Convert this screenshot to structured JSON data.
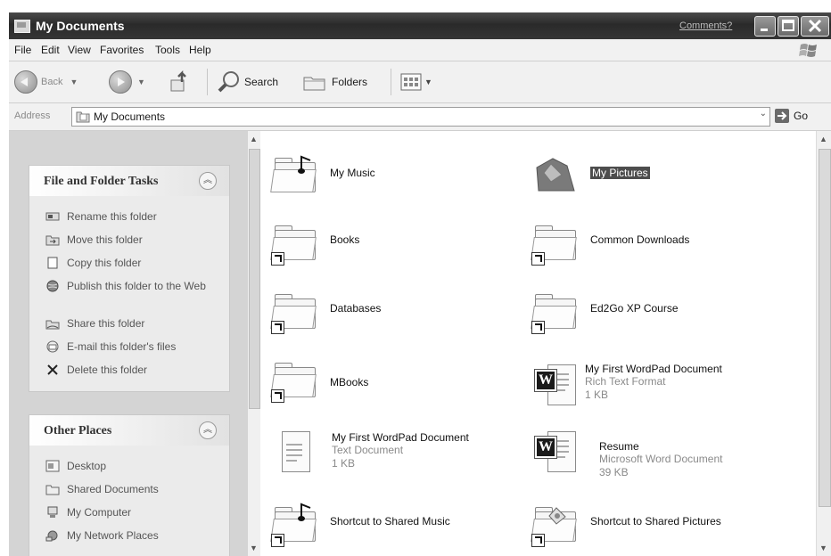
{
  "window": {
    "title": "My Documents",
    "comments_link": "Comments?",
    "controls": [
      "minimize-icon",
      "maximize-icon",
      "close-icon"
    ]
  },
  "menu": [
    "File",
    "Edit",
    "View",
    "Favorites",
    "Tools",
    "Help"
  ],
  "toolbar": {
    "back_label": "Back",
    "search_label": "Search",
    "folders_label": "Folders"
  },
  "address": {
    "label": "Address",
    "value": "My Documents",
    "go_label": "Go"
  },
  "file_folder_tasks": {
    "title": "File and Folder Tasks",
    "items": [
      "Rename this folder",
      "Move this folder",
      "Copy this folder",
      "Publish this folder to the Web",
      "Share this folder",
      "E-mail this folder's files",
      "Delete this folder"
    ]
  },
  "other_places": {
    "title": "Other Places",
    "items": [
      "Desktop",
      "Shared Documents",
      "My Computer",
      "My Network Places"
    ]
  },
  "files": [
    {
      "name": "My Music",
      "type": "special-folder"
    },
    {
      "name": "My Pictures",
      "type": "special-folder",
      "selected": true
    },
    {
      "name": "Books",
      "type": "folder-shortcut"
    },
    {
      "name": "Common Downloads",
      "type": "folder-shortcut"
    },
    {
      "name": "Databases",
      "type": "folder-shortcut"
    },
    {
      "name": "Ed2Go XP Course",
      "type": "folder-shortcut"
    },
    {
      "name": "MBooks",
      "type": "folder-shortcut"
    },
    {
      "name": "My First WordPad Document",
      "line2": "Rich Text Format",
      "line3": "1 KB",
      "type": "wordpad-doc"
    },
    {
      "name": "My First WordPad Document",
      "line2": "Text Document",
      "line3": "1 KB",
      "type": "text-doc"
    },
    {
      "name": "Resume",
      "line2": "Microsoft Word Document",
      "line3": "39 KB",
      "type": "word-doc"
    },
    {
      "name": "Shortcut to Shared Music",
      "type": "music-shortcut"
    },
    {
      "name": "Shortcut to Shared Pictures",
      "type": "pictures-shortcut"
    }
  ]
}
